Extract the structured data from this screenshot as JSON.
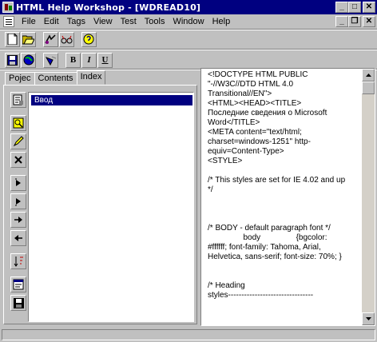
{
  "window": {
    "title": "HTML Help Workshop - [WDREAD10]",
    "caption_buttons": {
      "minimize": "_",
      "maximize": "□",
      "close": "✕"
    }
  },
  "menu": {
    "items": [
      "File",
      "Edit",
      "Tags",
      "View",
      "Test",
      "Tools",
      "Window",
      "Help"
    ],
    "doc_caption_buttons": {
      "minimize": "_",
      "restore": "❐",
      "close": "✕"
    }
  },
  "toolbar1": {
    "buttons": [
      {
        "name": "new-file",
        "icon": "new-document-icon"
      },
      {
        "name": "open-file",
        "icon": "open-folder-icon"
      },
      {
        "name": "compile",
        "icon": "compile-icon"
      },
      {
        "name": "view-compiled",
        "icon": "glasses-icon"
      },
      {
        "name": "help",
        "icon": "help-icon"
      }
    ]
  },
  "toolbar2": {
    "buttons": [
      {
        "name": "save",
        "icon": "save-icon"
      },
      {
        "name": "browser-view",
        "icon": "globe-icon"
      },
      {
        "name": "run",
        "icon": "run-icon"
      }
    ],
    "format": {
      "bold": "B",
      "italic": "I",
      "underline": "U"
    }
  },
  "tabs": [
    "Pojec",
    "Contents",
    "Index"
  ],
  "active_tab": "Index",
  "index_tools": [
    "index-properties-icon",
    "insert-keyword-icon",
    "edit-keyword-icon",
    "delete-keyword-icon",
    "move-up-icon",
    "move-down-icon",
    "move-right-icon",
    "move-left-icon",
    "sort-icon",
    "view-html-icon",
    "save-icon"
  ],
  "index_items": [
    "Ввод"
  ],
  "editor": {
    "lines": [
      "<!DOCTYPE HTML PUBLIC",
      "\"-//W3C//DTD HTML 4.0",
      "Transitional//EN\">",
      "<HTML><HEAD><TITLE>",
      "Последние сведения о Microsoft",
      "Word</TITLE>",
      "<META content=\"text/html;",
      "charset=windows-1251\" http-",
      "equiv=Content-Type>",
      "<STYLE>",
      "",
      "/* This styles are set for IE 4.02 and up",
      "*/",
      "",
      "",
      "",
      "/* BODY - default paragraph font */",
      "                body                {bgcolor:",
      "#ffffff; font-family: Tahoma, Arial,",
      "Helvetica, sans-serif; font-size: 70%; }",
      "",
      "",
      "/* Heading",
      "styles--------------------------------"
    ]
  },
  "colors": {
    "titlebar": "#000080",
    "face": "#c0c0c0",
    "selection": "#000080"
  }
}
